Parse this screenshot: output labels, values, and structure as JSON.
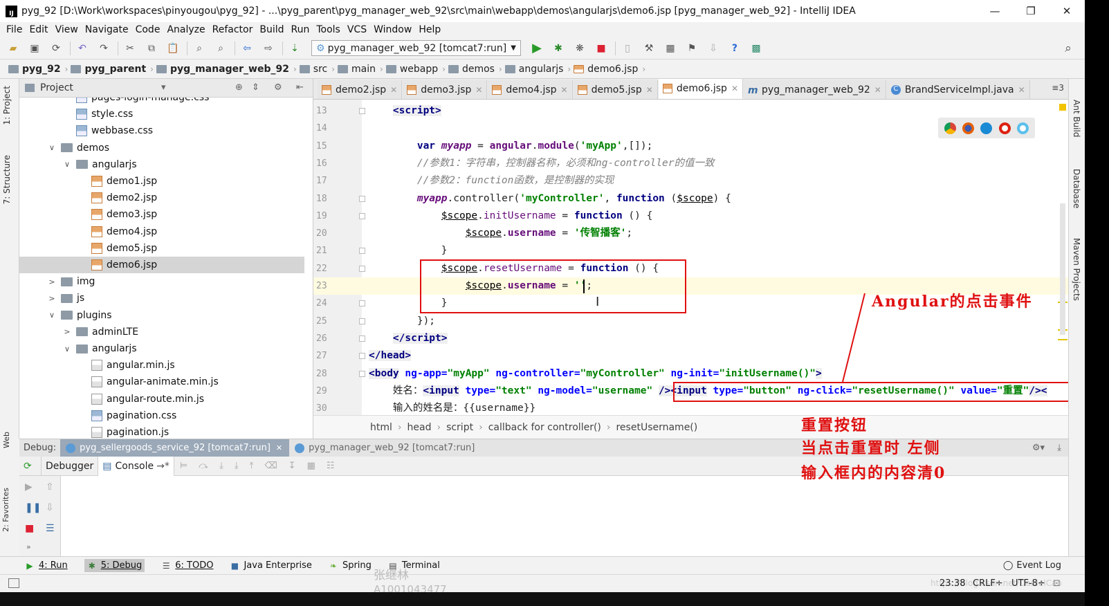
{
  "window": {
    "title": "pyg_92 [D:\\Work\\workspaces\\pinyougou\\pyg_92] - ...\\pyg_parent\\pyg_manager_web_92\\src\\main\\webapp\\demos\\angularjs\\demo6.jsp [pyg_manager_web_92] - IntelliJ IDEA",
    "minimize": "—",
    "restore": "❐",
    "close": "✕"
  },
  "menu": [
    "File",
    "Edit",
    "View",
    "Navigate",
    "Code",
    "Analyze",
    "Refactor",
    "Build",
    "Run",
    "Tools",
    "VCS",
    "Window",
    "Help"
  ],
  "toolbar": {
    "run_config": "pyg_manager_web_92 [tomcat7:run]"
  },
  "breadcrumbs": [
    "pyg_92",
    "pyg_parent",
    "pyg_manager_web_92",
    "src",
    "main",
    "webapp",
    "demos",
    "angularjs",
    "demo6.jsp"
  ],
  "left_tools": {
    "project": "1: Project",
    "structure": "7: Structure",
    "web": "Web",
    "favorites": "2: Favorites"
  },
  "right_tools": {
    "ant": "Ant Build",
    "database": "Database",
    "maven": "Maven Projects"
  },
  "project_panel": {
    "title": "Project",
    "tree": [
      {
        "label": "pages-login-manage.css",
        "icon": "css",
        "indent": 3,
        "arrow": ""
      },
      {
        "label": "style.css",
        "icon": "css",
        "indent": 3,
        "arrow": ""
      },
      {
        "label": "webbase.css",
        "icon": "css",
        "indent": 3,
        "arrow": ""
      },
      {
        "label": "demos",
        "icon": "folder",
        "indent": 2,
        "arrow": "∨"
      },
      {
        "label": "angularjs",
        "icon": "folder",
        "indent": 3,
        "arrow": "∨"
      },
      {
        "label": "demo1.jsp",
        "icon": "jsp",
        "indent": 4,
        "arrow": ""
      },
      {
        "label": "demo2.jsp",
        "icon": "jsp",
        "indent": 4,
        "arrow": ""
      },
      {
        "label": "demo3.jsp",
        "icon": "jsp",
        "indent": 4,
        "arrow": ""
      },
      {
        "label": "demo4.jsp",
        "icon": "jsp",
        "indent": 4,
        "arrow": ""
      },
      {
        "label": "demo5.jsp",
        "icon": "jsp",
        "indent": 4,
        "arrow": ""
      },
      {
        "label": "demo6.jsp",
        "icon": "jsp",
        "indent": 4,
        "arrow": "",
        "selected": true
      },
      {
        "label": "img",
        "icon": "folder",
        "indent": 2,
        "arrow": ">"
      },
      {
        "label": "js",
        "icon": "folder",
        "indent": 2,
        "arrow": ">"
      },
      {
        "label": "plugins",
        "icon": "folder",
        "indent": 2,
        "arrow": "∨"
      },
      {
        "label": "adminLTE",
        "icon": "folder",
        "indent": 3,
        "arrow": ">"
      },
      {
        "label": "angularjs",
        "icon": "folder",
        "indent": 3,
        "arrow": "∨"
      },
      {
        "label": "angular.min.js",
        "icon": "js",
        "indent": 4,
        "arrow": ""
      },
      {
        "label": "angular-animate.min.js",
        "icon": "js",
        "indent": 4,
        "arrow": ""
      },
      {
        "label": "angular-route.min.js",
        "icon": "js",
        "indent": 4,
        "arrow": ""
      },
      {
        "label": "pagination.css",
        "icon": "css",
        "indent": 4,
        "arrow": ""
      },
      {
        "label": "pagination.js",
        "icon": "js",
        "indent": 4,
        "arrow": ""
      }
    ]
  },
  "editor_tabs": [
    {
      "label": "demo2.jsp",
      "active": false
    },
    {
      "label": "demo3.jsp",
      "active": false
    },
    {
      "label": "demo4.jsp",
      "active": false
    },
    {
      "label": "demo5.jsp",
      "active": false
    },
    {
      "label": "demo6.jsp",
      "active": true
    },
    {
      "label": "pyg_manager_web_92",
      "active": false
    },
    {
      "label": "BrandServiceImpl.java",
      "active": false
    }
  ],
  "tabs_overflow": "≡3",
  "code_lines": [
    {
      "n": "13",
      "html": "    <span class=\"tag\">&lt;script&gt;</span>"
    },
    {
      "n": "14",
      "html": ""
    },
    {
      "n": "15",
      "html": "        <span class=\"kw\">var</span> <span class=\"var\">myapp</span> = <span class=\"propb\">angular</span>.<span class=\"propb\">module</span>(<span class=\"str\">'myApp'</span>,[]);"
    },
    {
      "n": "16",
      "html": "        <span class=\"cm\">//参数1：字符串，控制器名称，必须和ng-controller的值一致</span>"
    },
    {
      "n": "17",
      "html": "        <span class=\"cm\">//参数2：function函数，是控制器的实现</span>"
    },
    {
      "n": "18",
      "html": "        <span class=\"var\">myapp</span>.controller(<span class=\"str\">'myController'</span>, <span class=\"kw\">function</span> (<span class=\"sc\">$scope</span>) {"
    },
    {
      "n": "19",
      "html": "            <span class=\"sc\">$scope</span>.<span class=\"prop\">initUsername</span> = <span class=\"kw\">function</span> () {"
    },
    {
      "n": "20",
      "html": "                <span class=\"sc\">$scope</span>.<span class=\"propb\">username</span> = <span class=\"str\">'传智播客'</span>;"
    },
    {
      "n": "21",
      "html": "            }"
    },
    {
      "n": "22",
      "html": "            <span class=\"sc\">$scope</span>.<span class=\"prop\">resetUsername</span> = <span class=\"kw\">function</span> () {"
    },
    {
      "n": "23",
      "html": "                <span class=\"sc\">$scope</span>.<span class=\"propb\">username</span> = <span class=\"str\">''</span>;"
    },
    {
      "n": "24",
      "html": "            }"
    },
    {
      "n": "25",
      "html": "        });"
    },
    {
      "n": "26",
      "html": "    <span class=\"tag\">&lt;/script&gt;</span>"
    },
    {
      "n": "27",
      "html": "<span class=\"tag\">&lt;/head&gt;</span>"
    },
    {
      "n": "28",
      "html": "<span class=\"tag\">&lt;body</span> <span class=\"attr\">ng-app=</span><span class=\"aval\">\"myApp\"</span> <span class=\"attr\">ng-controller=</span><span class=\"aval\">\"myController\"</span> <span class=\"attr\">ng-init=</span><span class=\"aval\">\"initUsername()\"</span><span class=\"tag\">&gt;</span>"
    },
    {
      "n": "29",
      "html": "    姓名：<span class=\"tag\">&lt;input</span> <span class=\"attr\">type=</span><span class=\"aval\">\"text\"</span> <span class=\"attr\">ng-model=</span><span class=\"aval\">\"username\"</span> <span class=\"tag\">/&gt;&lt;input</span> <span class=\"attr\">type=</span><span class=\"aval\">\"button\"</span> <span class=\"attr\">ng-click=</span><span class=\"aval\">\"resetUsername()\"</span> <span class=\"attr\">value=</span><span class=\"aval\">\"重置\"</span><span class=\"tag\">/&gt;&lt;</span>"
    },
    {
      "n": "30",
      "html": "    输入的姓名是：{{username}}"
    }
  ],
  "code_breadcrumb": [
    "html",
    "head",
    "script",
    "callback for controller()",
    "resetUsername()"
  ],
  "annotations": {
    "top": "Angular的点击事件",
    "line1": "重置按钮",
    "line2": "当点击重置时  左侧",
    "line3": "输入框内的内容清0"
  },
  "debug": {
    "label": "Debug:",
    "tabs": [
      "pyg_sellergoods_service_92 [tomcat7:run]",
      "pyg_manager_web_92 [tomcat7:run]"
    ],
    "debugger": "Debugger",
    "console": "Console"
  },
  "bottom_tools": [
    {
      "label": "4: Run",
      "icon": "▶",
      "color": "#2a9b2a"
    },
    {
      "label": "5: Debug",
      "icon": "✱",
      "color": "#3a7d3a",
      "active": true
    },
    {
      "label": "6: TODO",
      "icon": "☰",
      "color": "#555"
    },
    {
      "label": "Java Enterprise",
      "icon": "■",
      "color": "#3a6ea5"
    },
    {
      "label": "Spring",
      "icon": "❧",
      "color": "#6aae3a"
    },
    {
      "label": "Terminal",
      "icon": "▤",
      "color": "#444"
    }
  ],
  "event_log": "Event Log",
  "status": {
    "position": "23:38",
    "line_sep": "CRLF÷",
    "encoding": "UTF-8÷"
  },
  "watermark": {
    "name": "张继林",
    "id": "A1001043477",
    "url": "https://blog.csdn.net/DanielCao"
  }
}
